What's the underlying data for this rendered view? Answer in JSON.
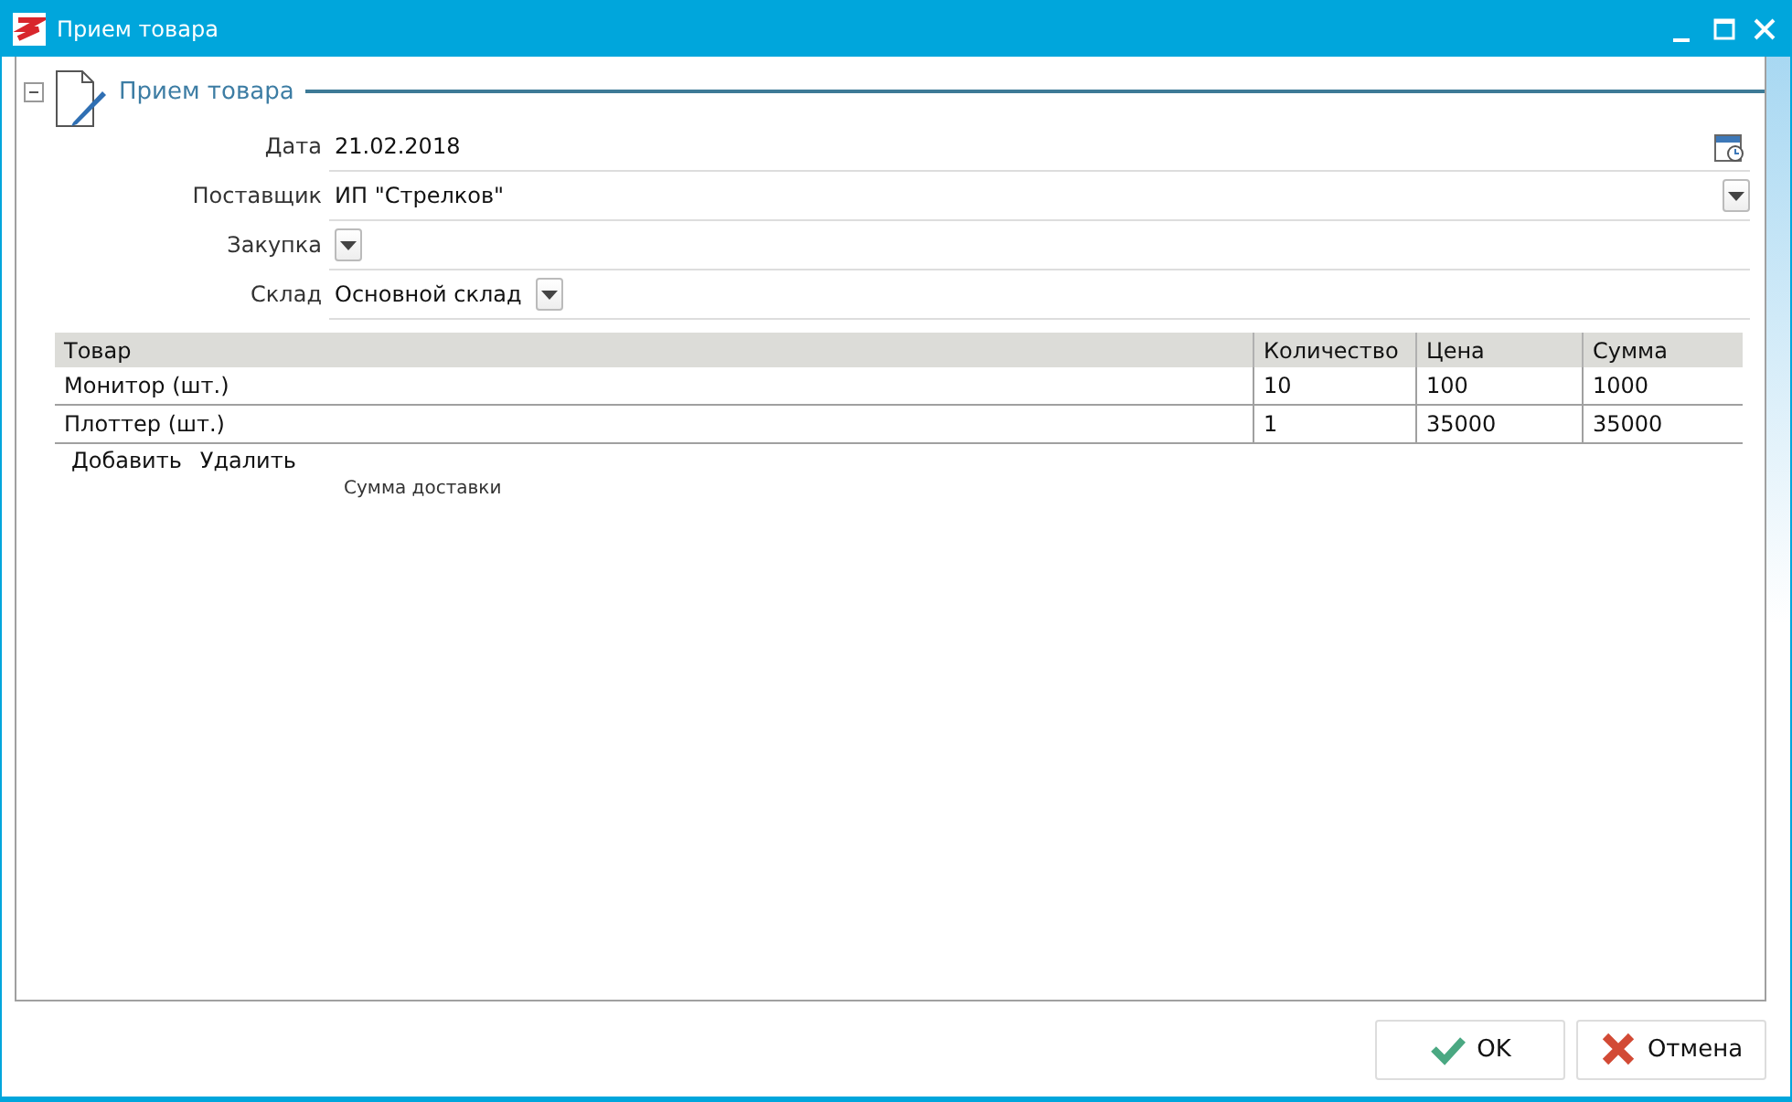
{
  "window": {
    "title": "Прием товара"
  },
  "group": {
    "title": "Прием товара",
    "expanded": true
  },
  "fields": [
    {
      "label": "Дата",
      "kind": "date",
      "value": "21.02.2018"
    },
    {
      "label": "Поставщик",
      "kind": "combo",
      "value": "ИП \"Стрелков\""
    },
    {
      "label": "Закупка",
      "kind": "dropdown"
    },
    {
      "label": "Склад",
      "kind": "dropdown",
      "value": "Основной склад"
    }
  ],
  "table": {
    "columns": [
      "Товар",
      "Количество",
      "Цена",
      "Сумма"
    ],
    "rows": [
      [
        "Монитор (шт.)",
        "10",
        "100",
        "1000"
      ],
      [
        "Плоттер (шт.)",
        "1",
        "35000",
        "35000"
      ]
    ]
  },
  "table_actions": [
    "Добавить",
    "Удалить"
  ],
  "delivery_label": "Сумма доставки",
  "buttons": [
    {
      "label": "OK",
      "kind": "ok"
    },
    {
      "label": "Отмена",
      "kind": "cancel"
    }
  ]
}
